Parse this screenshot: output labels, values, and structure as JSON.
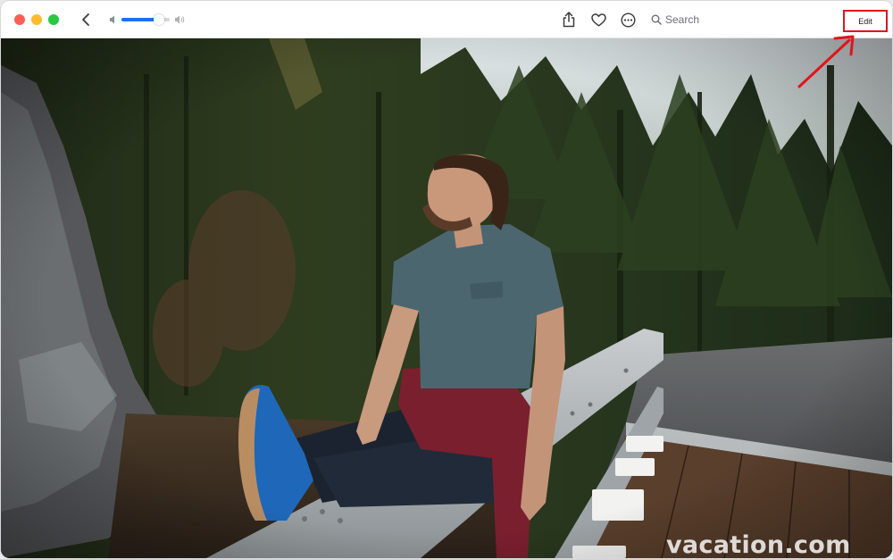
{
  "toolbar": {
    "traffic_lights": {
      "close_color": "#ff5f57",
      "minimize_color": "#febc2e",
      "maximize_color": "#28c840"
    },
    "volume_level": 0.78,
    "search_placeholder": "Search",
    "edit_label": "Edit",
    "icons": [
      "chevron-left-icon",
      "speaker-low-icon",
      "speaker-high-icon",
      "share-icon",
      "heart-icon",
      "ellipsis-circle-icon",
      "search-icon"
    ]
  },
  "photo": {
    "watermark": "vacation.com"
  },
  "annotation": {
    "highlight_color": "#e0141e",
    "target": "edit-button"
  }
}
